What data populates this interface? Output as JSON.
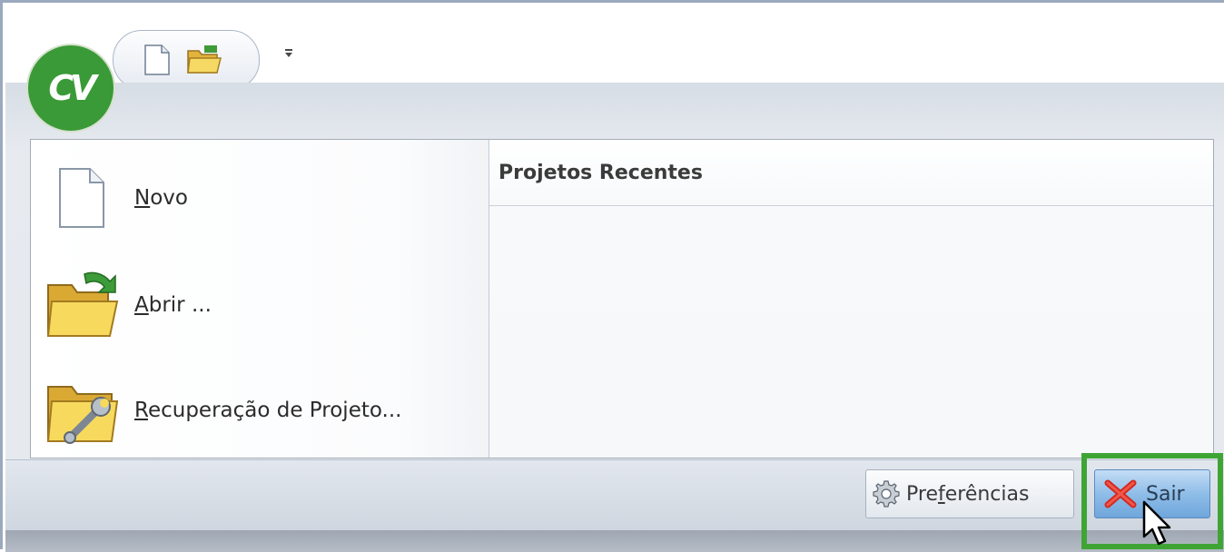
{
  "app": {
    "logo_text": "CV"
  },
  "quick_access": {
    "items": [
      "new-document",
      "open-folder"
    ],
    "customize_icon": "dropdown-arrow-icon"
  },
  "menu": {
    "commands": [
      {
        "label": "Novo",
        "access_key": "N",
        "rest": "ovo",
        "icon": "document-icon"
      },
      {
        "label": "Abrir ...",
        "access_key": "A",
        "rest": "brir ...",
        "icon": "open-folder-icon"
      },
      {
        "label": "Recuperação de Projeto...",
        "access_key": "R",
        "rest": "ecuperação de Projeto...",
        "icon": "folder-wrench-icon"
      }
    ]
  },
  "recent": {
    "header": "Projetos Recentes",
    "items": []
  },
  "footer": {
    "preferences": {
      "label": "Preferências",
      "pre": "Pre",
      "access_key": "f",
      "post": "erências",
      "icon": "gear-icon"
    },
    "exit": {
      "label": "Sair",
      "icon": "red-x-icon"
    }
  },
  "colors": {
    "logo_green": "#3a9a37",
    "highlight_green": "#3ea535",
    "exit_blue": "#8fbde8"
  }
}
